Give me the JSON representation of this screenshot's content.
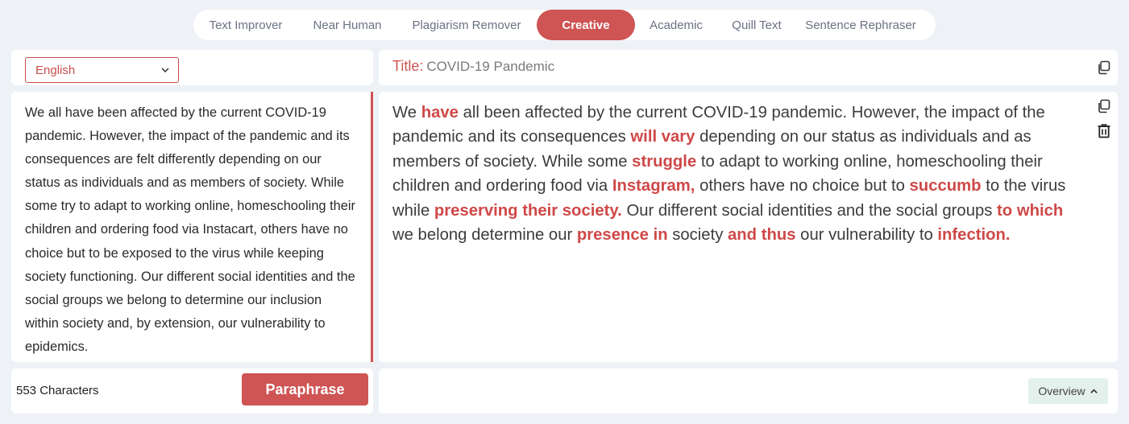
{
  "tabs": [
    {
      "label": "Text Improver",
      "active": false
    },
    {
      "label": "Near Human",
      "active": false
    },
    {
      "label": "Plagiarism Remover",
      "active": false
    },
    {
      "label": "Creative",
      "active": true
    },
    {
      "label": "Academic",
      "active": false
    },
    {
      "label": "Quill Text",
      "active": false
    },
    {
      "label": "Sentence Rephraser",
      "active": false
    }
  ],
  "language": {
    "selected": "English",
    "icon": "chevron-down-icon"
  },
  "title": {
    "label": "Title:",
    "value": "COVID-19 Pandemic",
    "copy_icon": "copy-icon"
  },
  "input": {
    "text": "We all have been affected by the current COVID-19 pandemic. However, the impact of the pandemic and its consequences are felt differently depending on our status as individuals and as members of society. While some try to adapt to working online, homeschooling their children and ordering food via Instacart, others have no choice but to be exposed to the virus while keeping society functioning. Our different social identities and the social groups we belong to determine our inclusion within society and, by extension, our vulnerability to epidemics."
  },
  "output": {
    "segments": [
      {
        "text": "We ",
        "hl": false
      },
      {
        "text": "have",
        "hl": true
      },
      {
        "text": " all been affected by the current COVID-19 pandemic. However, the impact of the pandemic and its consequences ",
        "hl": false
      },
      {
        "text": "will vary",
        "hl": true
      },
      {
        "text": " depending on our status as individuals and as members of society. While some ",
        "hl": false
      },
      {
        "text": "struggle",
        "hl": true
      },
      {
        "text": " to adapt to working online, homeschooling their children and ordering food via ",
        "hl": false
      },
      {
        "text": "Instagram,",
        "hl": true
      },
      {
        "text": " others have no choice but to ",
        "hl": false
      },
      {
        "text": "succumb",
        "hl": true
      },
      {
        "text": " to the virus while ",
        "hl": false
      },
      {
        "text": "preserving their society.",
        "hl": true
      },
      {
        "text": " Our different social identities and the social groups ",
        "hl": false
      },
      {
        "text": "to which",
        "hl": true
      },
      {
        "text": " we belong determine our ",
        "hl": false
      },
      {
        "text": "presence in",
        "hl": true
      },
      {
        "text": " society ",
        "hl": false
      },
      {
        "text": "and thus",
        "hl": true
      },
      {
        "text": " our vulnerability to ",
        "hl": false
      },
      {
        "text": "infection.",
        "hl": true
      }
    ],
    "icons": [
      "copy-icon",
      "trash-icon"
    ]
  },
  "footer": {
    "char_count": "553 Characters",
    "paraphrase_label": "Paraphrase",
    "overview_label": "Overview",
    "overview_icon": "chevron-up-icon"
  },
  "colors": {
    "accent": "#cf5454",
    "background": "#eef2f6",
    "overview_bg": "#e4f0ec"
  }
}
